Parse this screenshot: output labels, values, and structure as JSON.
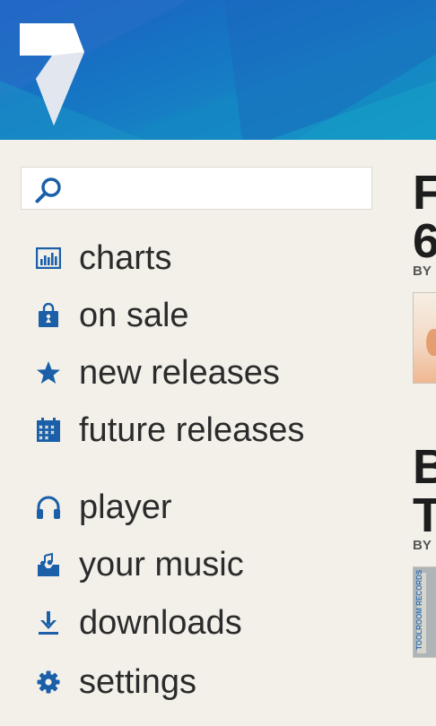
{
  "colors": {
    "header_start": "#1a5fc0",
    "header_end": "#169ac6",
    "icon_blue": "#1a5fa8",
    "background": "#f2f0e9",
    "text": "#2b2b2b"
  },
  "search": {
    "placeholder": "",
    "value": ""
  },
  "menu": {
    "primary": [
      {
        "label": "charts",
        "icon": "bar-chart-icon"
      },
      {
        "label": "on sale",
        "icon": "shopping-bag-icon"
      },
      {
        "label": "new releases",
        "icon": "star-icon"
      },
      {
        "label": "future releases",
        "icon": "calendar-icon"
      }
    ],
    "secondary": [
      {
        "label": "player",
        "icon": "headphones-icon"
      },
      {
        "label": "your music",
        "icon": "music-library-icon"
      },
      {
        "label": "downloads",
        "icon": "download-icon"
      },
      {
        "label": "settings",
        "icon": "gear-icon"
      }
    ]
  },
  "peek": {
    "item1": {
      "title_line1": "F",
      "title_line2": "6",
      "by_label": "BY"
    },
    "item2": {
      "title_line1": "B",
      "title_line2": "T",
      "by_label": "BY",
      "art_text": "TOOLROOM RECORDS"
    }
  }
}
